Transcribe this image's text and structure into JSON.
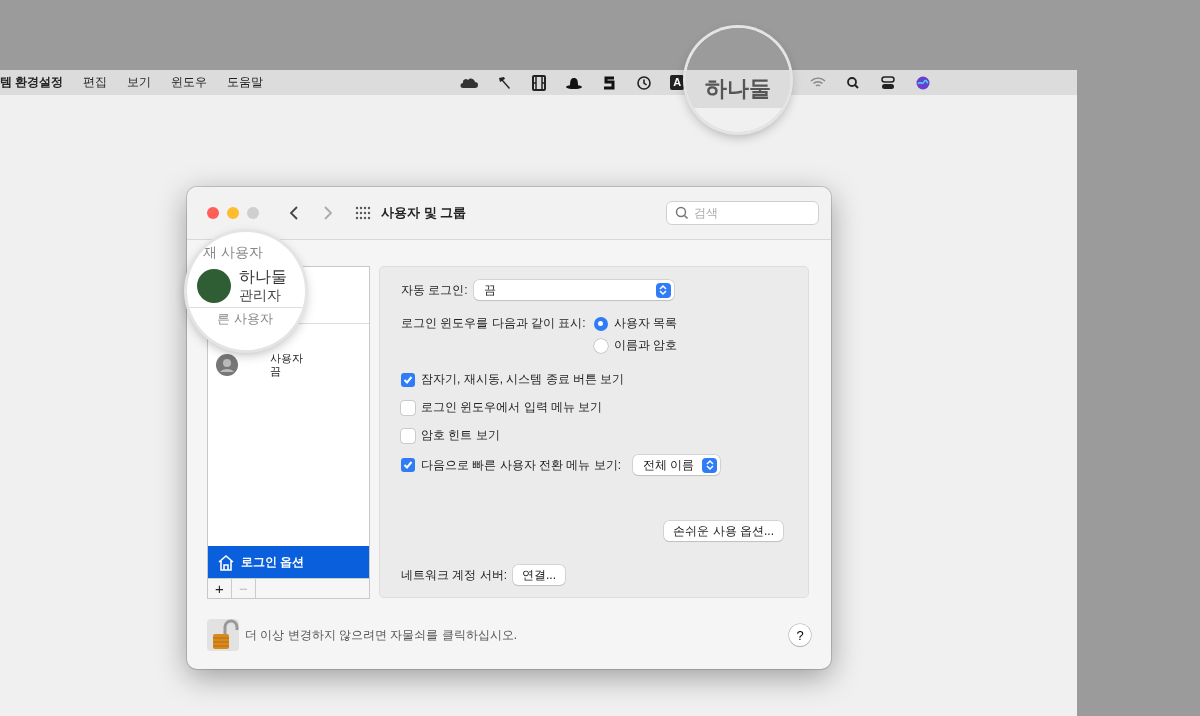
{
  "menubar": {
    "app_menu": "템 환경설정",
    "menus": [
      "편집",
      "보기",
      "윈도우",
      "도움말"
    ],
    "input_source": "A"
  },
  "magnifiers": [
    {
      "kind": "menubar",
      "text": "하나둘"
    },
    {
      "kind": "sidebar",
      "heading": "재 사용자",
      "user_name": "하나둘",
      "user_role": "관리자",
      "section": "른 사용자"
    }
  ],
  "window": {
    "title": "사용자 및 그룹",
    "search": {
      "placeholder": "검색"
    }
  },
  "sidebar": {
    "other_users": [
      {
        "name": "사용자",
        "status": "끔"
      }
    ],
    "login_options": {
      "label": "로그인 옵션",
      "selected": true
    },
    "buttons": [
      {
        "label": "+",
        "disabled": false
      },
      {
        "label": "−",
        "disabled": true
      }
    ]
  },
  "auto_login": {
    "label": "자동 로그인:",
    "value": "끔"
  },
  "login_window_display": {
    "label": "로그인 윈도우를 다음과 같이 표시:",
    "options": [
      {
        "label": "사용자 목록",
        "selected": true
      },
      {
        "label": "이름과 암호",
        "selected": false
      }
    ]
  },
  "checkboxes": [
    {
      "label": "잠자기, 재시동, 시스템 종료 버튼 보기",
      "checked": true
    },
    {
      "label": "로그인 윈도우에서 입력 메뉴 보기",
      "checked": false
    },
    {
      "label": "암호 힌트 보기",
      "checked": false
    },
    {
      "label": "다음으로 빠른 사용자 전환 메뉴 보기:",
      "checked": true,
      "popup": "전체 이름"
    }
  ],
  "accessibility_button": "손쉬운 사용 옵션...",
  "network_server": {
    "label": "네트워크 계정 서버:",
    "button": "연결..."
  },
  "footer": {
    "locked": false,
    "message": "더 이상 변경하지 않으려면 자물쇠를 클릭하십시오.",
    "help_button": "?"
  }
}
